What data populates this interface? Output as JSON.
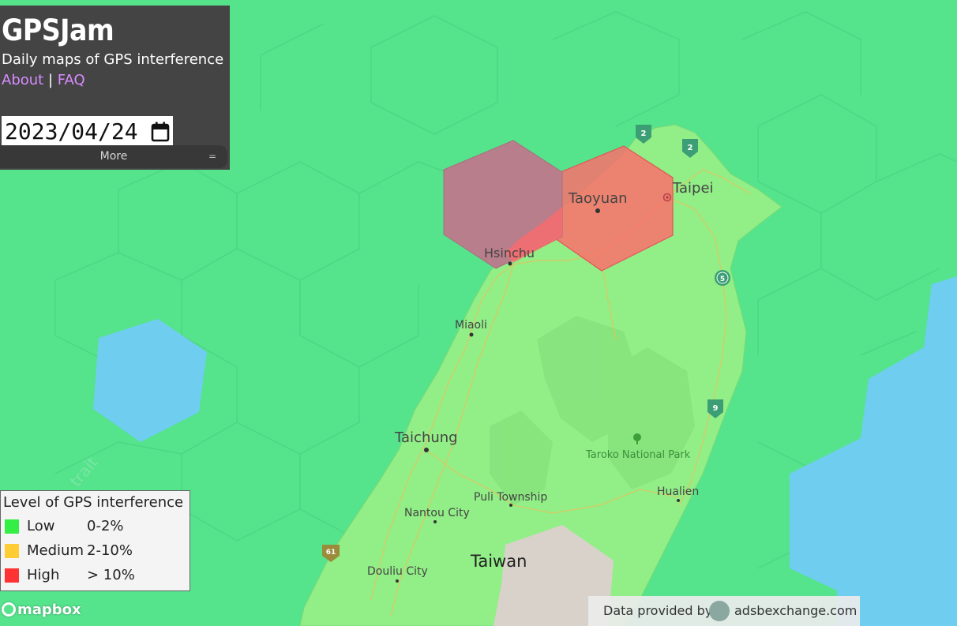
{
  "app": {
    "title": "GPSJam",
    "subtitle": "Daily maps of GPS interference",
    "links": {
      "about": "About",
      "separator": "|",
      "faq": "FAQ"
    },
    "date_value": "2023/04/24",
    "more_label": "More",
    "more_grip": "="
  },
  "legend": {
    "title": "Level of GPS interference",
    "items": [
      {
        "name": "Low",
        "range": "0-2%",
        "color": "#33ee44"
      },
      {
        "name": "Medium",
        "range": "2-10%",
        "color": "#ffcc33"
      },
      {
        "name": "High",
        "range": "> 10%",
        "color": "#ff3333"
      }
    ]
  },
  "map": {
    "place_labels": {
      "taipei": "Taipei",
      "taoyuan": "Taoyuan",
      "hsinchu": "Hsinchu",
      "miaoli": "Miaoli",
      "taichung": "Taichung",
      "taroko": "Taroko National Park",
      "hualien": "Hualien",
      "puli": "Puli Township",
      "nantou": "Nantou City",
      "taiwan": "Taiwan",
      "douliu": "Douliu City",
      "strait": "trait"
    },
    "route_shields": {
      "r2a": "2",
      "r2b": "2",
      "r5": "5",
      "r9": "9",
      "r61": "61"
    },
    "colors": {
      "hex_low": "#55e38c",
      "land": "#92ee87",
      "hex_high": "#ff6b6b",
      "hex_purple": "#b87e8c",
      "water_hex": "#6fcdf0",
      "unknown_hex": "#d9d2ca"
    }
  },
  "attribution": {
    "prefix": "Data provided by",
    "site": "adsbexchange.com",
    "mapbox": "mapbox"
  }
}
